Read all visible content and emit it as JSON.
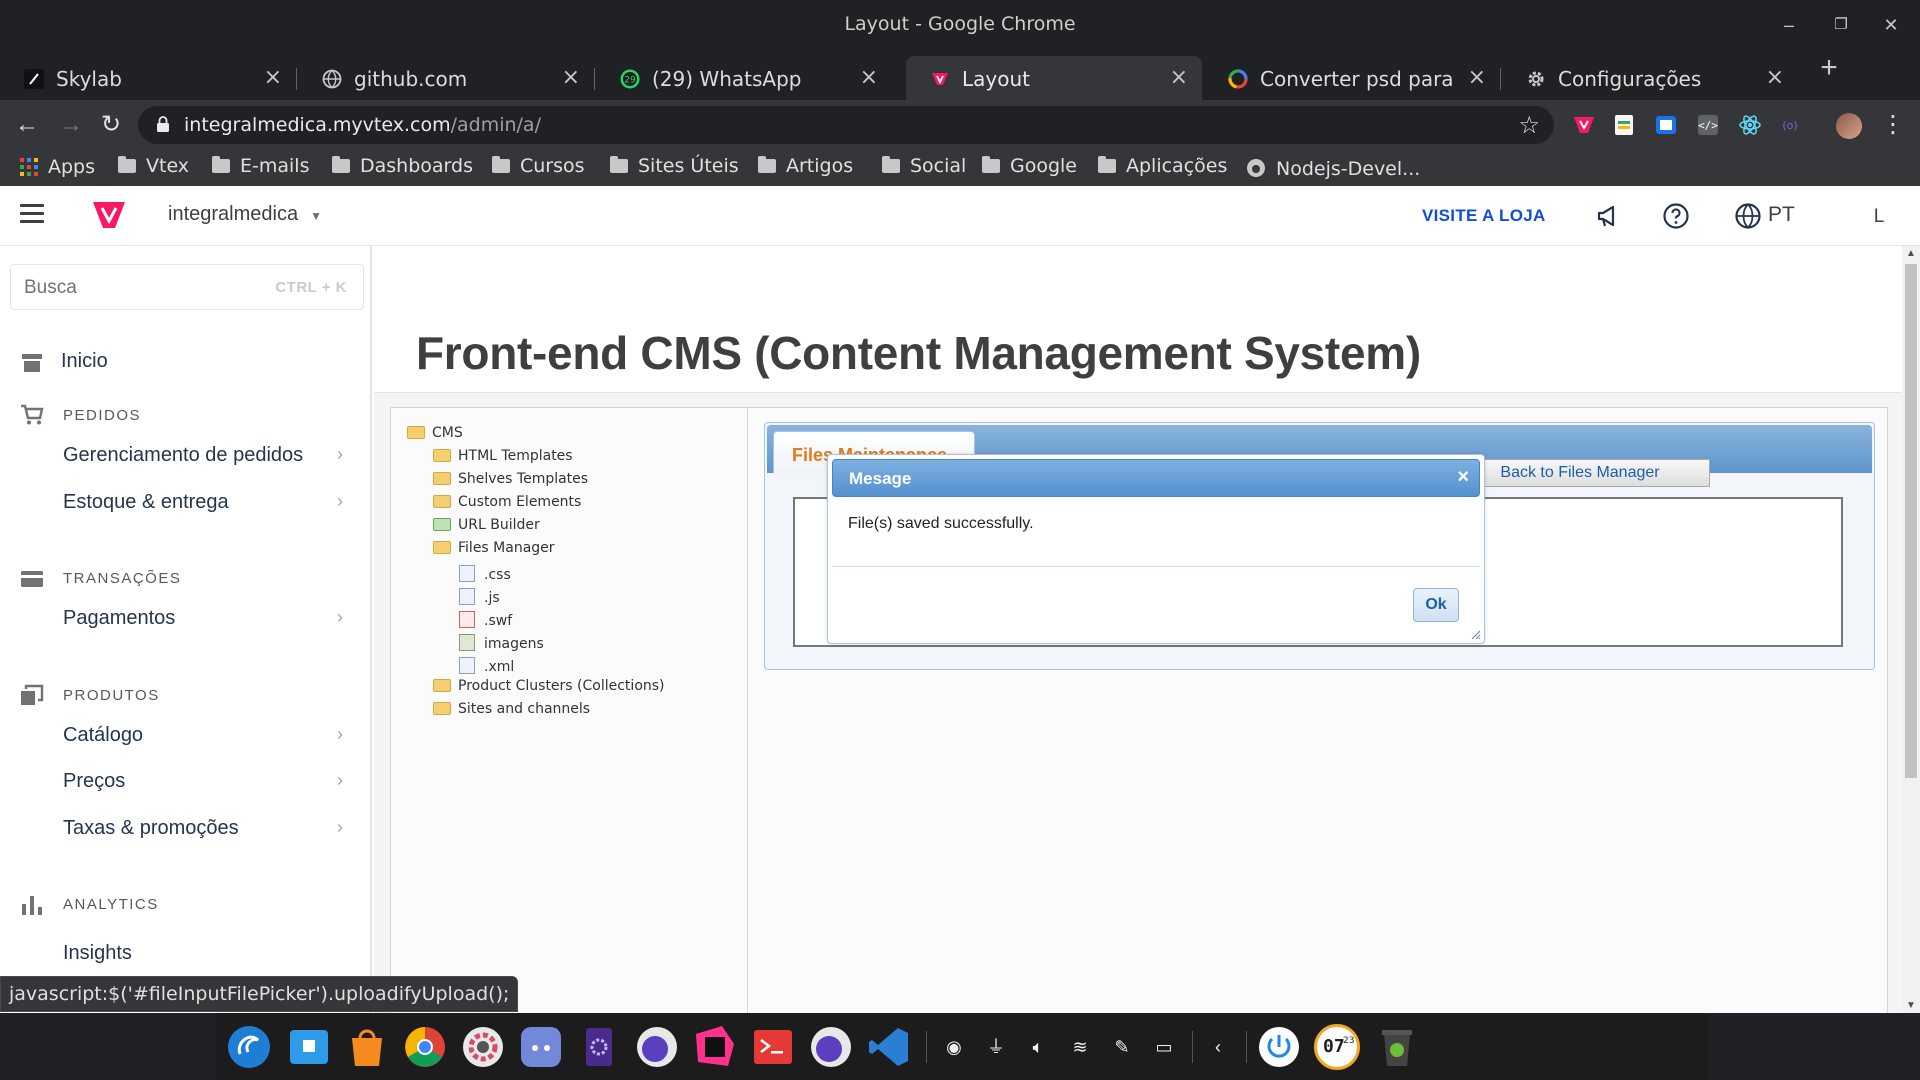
{
  "window": {
    "title": "Layout - Google Chrome"
  },
  "tabs": [
    {
      "label": "Skylab",
      "active": false
    },
    {
      "label": "github.com",
      "active": false
    },
    {
      "label": "(29) WhatsApp",
      "active": false
    },
    {
      "label": "Layout",
      "active": true
    },
    {
      "label": "Converter psd para pag",
      "active": false
    },
    {
      "label": "Configurações",
      "active": false
    }
  ],
  "whatsapp_badge": "29",
  "address": {
    "host": "integralmedica.myvtex.com",
    "path": "/admin/a/"
  },
  "bookmarks": [
    "Apps",
    "Vtex",
    "E-mails",
    "Dashboards",
    "Cursos",
    "Sites Úteis",
    "Artigos",
    "Social",
    "Google",
    "Aplicações",
    "Nodejs-Devel..."
  ],
  "vtex": {
    "account": "integralmedica",
    "visit_store": "VISITE A LOJA",
    "language": "PT",
    "user_initial": "L",
    "brand_color": "#f71963",
    "link_color": "#134cd8"
  },
  "sidebar": {
    "search_placeholder": "Busca",
    "search_shortcut": "CTRL + K",
    "home": "Inicio",
    "sections": [
      {
        "title": "PEDIDOS",
        "icon": "cart-icon",
        "items": [
          "Gerenciamento de pedidos",
          "Estoque & entrega"
        ]
      },
      {
        "title": "TRANSAÇÕES",
        "icon": "card-icon",
        "items": [
          "Pagamentos"
        ]
      },
      {
        "title": "PRODUTOS",
        "icon": "box-icon",
        "items": [
          "Catálogo",
          "Preços",
          "Taxas & promoções"
        ]
      },
      {
        "title": "ANALYTICS",
        "icon": "bar-chart-icon",
        "items": [
          "Insights"
        ]
      }
    ]
  },
  "page": {
    "title": "Front-end CMS (Content Management System)"
  },
  "tree": {
    "root": "CMS",
    "children": [
      "HTML Templates",
      "Shelves Templates",
      "Custom Elements",
      "URL Builder",
      "Files Manager"
    ],
    "files": [
      ".css",
      ".js",
      ".swf",
      "imagens",
      ".xml"
    ],
    "after": [
      "Product Clusters (Collections)",
      "Sites and channels"
    ]
  },
  "panel": {
    "tab": "Files Maintenance",
    "back_button": "Back to Files Manager"
  },
  "dialog": {
    "title": "Mesage",
    "message": "File(s) saved successfully.",
    "ok": "Ok",
    "close": "×"
  },
  "status_bar": "javascript:$('#fileInputFilePicker').uploadifyUpload();",
  "clock": {
    "hour": "07",
    "minute": "23"
  }
}
